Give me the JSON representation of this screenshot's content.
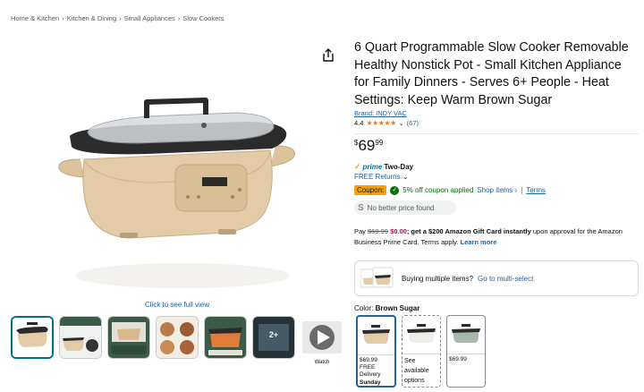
{
  "breadcrumb": [
    "Home & Kitchen",
    "Kitchen & Dining",
    "Small Appliances",
    "Slow Cookers"
  ],
  "breadcrumb_sep": "›",
  "product": {
    "title": "6 Quart Programmable Slow Cooker Removable Healthy Nonstick Pot - Small Kitchen Appliance for Family Dinners - Serves 6+ People - Heat Settings: Keep Warm Brown Sugar",
    "brand": "Brand: INDY VAC",
    "rating_value": "4.4",
    "rating_stars": 4.4,
    "stars_text": "★★★★★",
    "rating_count": "(67)",
    "price_symbol": "$",
    "price_whole": "69",
    "price_fraction": "99"
  },
  "delivery": {
    "prime_check": "✓",
    "prime_word": "prime",
    "prime_suffix": "Two-Day",
    "free_returns": "FREE Returns",
    "free_returns_chevron": "⌄"
  },
  "coupon": {
    "badge": "Coupon:",
    "text": "5% off coupon applied",
    "shop": "Shop items ›",
    "divider": "|",
    "terms": "Terms"
  },
  "no_better_price": {
    "icon": "S",
    "text": "No better price found"
  },
  "pay": {
    "prefix": "Pay ",
    "old": "$69.99",
    "new": "$0.00",
    "bold": "; get a $200 Amazon Gift Card instantly",
    "rest": " upon approval for the Amazon Business Prime Card. Terms apply. ",
    "learn": "Learn more"
  },
  "multi": {
    "text": "Buying multiple items?",
    "link": "Go to multi-select"
  },
  "color": {
    "label": "Color: ",
    "value": "Brown Sugar"
  },
  "swatches": [
    {
      "price": "$69.99",
      "delivery1": "FREE Delivery",
      "delivery2": "Sunday"
    },
    {
      "see1": "See",
      "see2": "available",
      "see3": "options"
    },
    {
      "price": "$69.99"
    }
  ],
  "media": {
    "see_full_view": "Click to see full view",
    "more_count": "2+",
    "watch": "Watch"
  },
  "icons": [
    "share-icon",
    "star-icon",
    "prime-check-icon",
    "chevron-down-icon",
    "check-circle-icon",
    "play-icon"
  ],
  "colors": {
    "link": "#2162a1",
    "coupon_badge": "#f7a200",
    "coupon_text": "#007600",
    "price_red": "#cc0c39",
    "star": "#de7921",
    "prime_blue": "#0074a6"
  }
}
